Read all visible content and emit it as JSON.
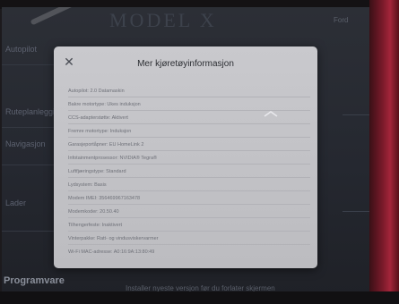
{
  "background": {
    "brand": "MODEL X",
    "top_right": "Ford",
    "left_rows": [
      "Autopilot",
      "Ruteplanlegging",
      "Navigasjon",
      "Lader",
      "Programvare"
    ],
    "bottom_text": "Installer nyeste versjon før du forlater skjermen",
    "section": "Programvare"
  },
  "dialog": {
    "title": "Mer kjøretøyinformasjon",
    "close_icon": "close-icon",
    "items": [
      "Autopilot: 2.0 Datamaskin",
      "Bakre motortype: Ukes induksjon",
      "CCS-adapterstøtte: Aktivert",
      "Fremre motortype: Induksjon",
      "Garasjeportåpner: EU HomeLink 2",
      "Infotainmentprosessor: NVIDIA® Tegra®",
      "Luftfjæringstype: Standard",
      "Lydsystem: Basis",
      "Modem IMEI: 356469967163478",
      "Modemkoder: 20.50.40",
      "Tilhengerfeste: Inaktivert",
      "Vinterpakke: Ratt- og vindusviskervarmer",
      "Wi-Fi MAC-adresse: A0:16:9A:13:80:49"
    ]
  },
  "colors": {
    "dialog_bg": "#c9c9cd",
    "screen_bg": "#2c2f36",
    "bezel_red": "#a3253a"
  }
}
